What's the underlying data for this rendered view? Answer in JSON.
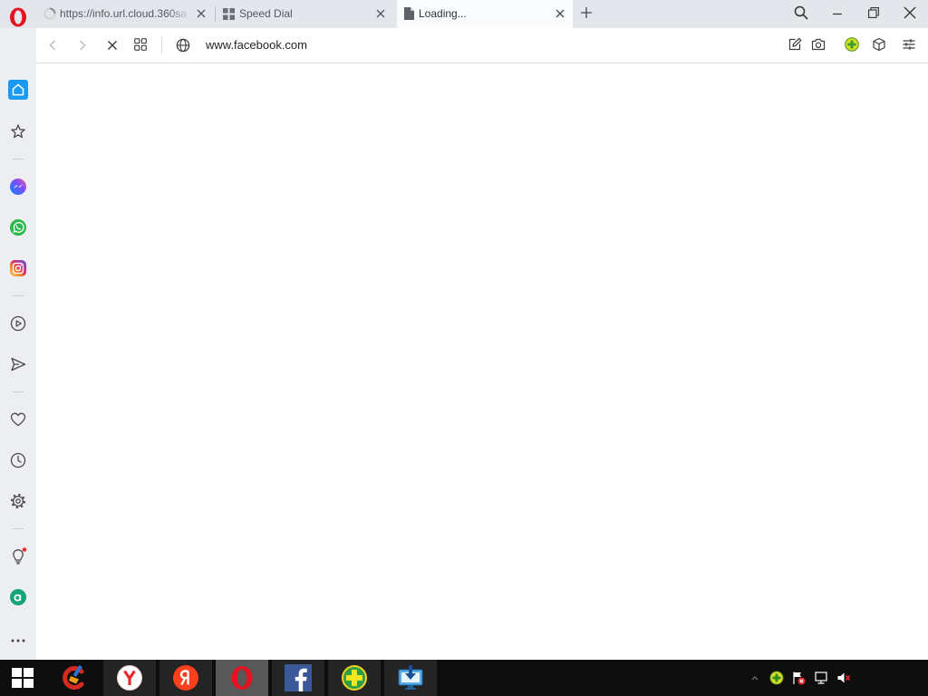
{
  "window": {
    "logo_icon": "opera-logo-icon",
    "tabs": [
      {
        "title": "https://info.url.cloud.360sa",
        "icon": "loading-spinner-icon",
        "active": false
      },
      {
        "title": "Speed Dial",
        "icon": "speed-dial-icon",
        "active": false
      },
      {
        "title": "Loading...",
        "icon": "document-icon",
        "active": true
      }
    ],
    "new_tab_icon": "plus-icon",
    "controls": [
      "search-tabs-icon",
      "minimize-icon",
      "restore-icon",
      "close-icon"
    ]
  },
  "address_bar": {
    "url": "www.facebook.com",
    "navigation_icons": [
      "back-icon",
      "forward-icon",
      "stop-loading-icon",
      "tab-tiles-icon"
    ],
    "site_icon": "globe-icon",
    "toolbar_icons": [
      "edit-icon",
      "snapshot-icon",
      "360-extension-icon",
      "extensions-cube-icon",
      "easy-setup-icon"
    ]
  },
  "sidebar": {
    "items": [
      {
        "icon": "home-icon",
        "active": true
      },
      {
        "icon": "bookmarks-star-icon"
      },
      {
        "icon": "messenger-icon"
      },
      {
        "icon": "whatsapp-icon"
      },
      {
        "icon": "instagram-icon"
      },
      {
        "icon": "player-icon"
      },
      {
        "icon": "flow-send-icon"
      },
      {
        "icon": "heart-icon"
      },
      {
        "icon": "history-clock-icon"
      },
      {
        "icon": "settings-gear-icon"
      },
      {
        "icon": "lightbulb-icon",
        "badge": true
      },
      {
        "icon": "green-a-icon"
      },
      {
        "icon": "more-dots-icon"
      }
    ]
  },
  "taskbar": {
    "start_icon": "windows-start-icon",
    "apps": [
      {
        "icon": "ccleaner-icon",
        "running": false
      },
      {
        "icon": "yandex-browser-icon",
        "running": true
      },
      {
        "icon": "yandex-icon",
        "running": true
      },
      {
        "icon": "opera-icon",
        "running": true,
        "active": true
      },
      {
        "icon": "facebook-icon",
        "running": true
      },
      {
        "icon": "360-security-icon",
        "running": true
      },
      {
        "icon": "download-manager-icon",
        "running": true
      }
    ],
    "tray": [
      "show-hidden-icons-chevron-icon",
      "360-tray-icon",
      "action-center-flag-icon",
      "network-icon",
      "volume-muted-icon"
    ]
  },
  "colors": {
    "opera_red": "#e8111f",
    "sidebar_active_blue": "#1b9af5",
    "tab_strip": "#e3e6ea",
    "sidebar": "#eceef1",
    "taskbar": "#0e0e0e"
  }
}
